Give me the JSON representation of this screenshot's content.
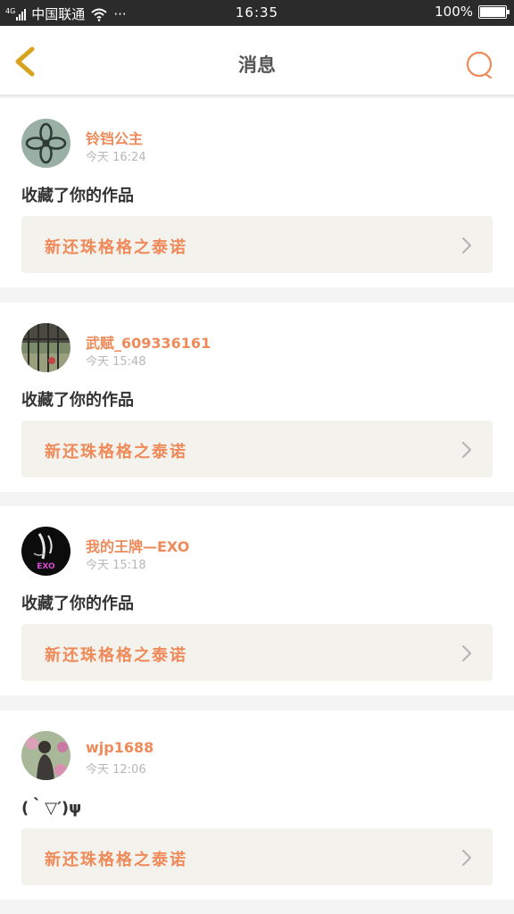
{
  "status_bar": {
    "network": "4G",
    "carrier": "中国联通",
    "dots": "···",
    "time": "16:35",
    "battery_label": "100%",
    "battery_level": 1.0
  },
  "header": {
    "title": "消息"
  },
  "messages": [
    {
      "username": "铃铛公主",
      "time": "今天 16:24",
      "content": "收藏了你的作品",
      "work_title": "新还珠格格之泰诺"
    },
    {
      "username": "武赋_609336161",
      "time": "今天 15:48",
      "content": "收藏了你的作品",
      "work_title": "新还珠格格之泰诺"
    },
    {
      "username": "我的王牌—EXO",
      "time": "今天 15:18",
      "content": "收藏了你的作品",
      "work_title": "新还珠格格之泰诺",
      "avatar_text": "EXO"
    },
    {
      "username": "wjp1688",
      "time": "今天 12:06",
      "content": "(｀▽′)ψ",
      "work_title": "新还珠格格之泰诺"
    }
  ],
  "colors": {
    "accent": "#ef8a5a",
    "back_icon": "#d7a31a",
    "link_bg": "#f3f2ec",
    "status_bar_bg": "#2b2b2b"
  },
  "icons": {
    "back": "chevron-left-icon",
    "search": "search-icon",
    "row_arrow": "chevron-right-icon"
  }
}
